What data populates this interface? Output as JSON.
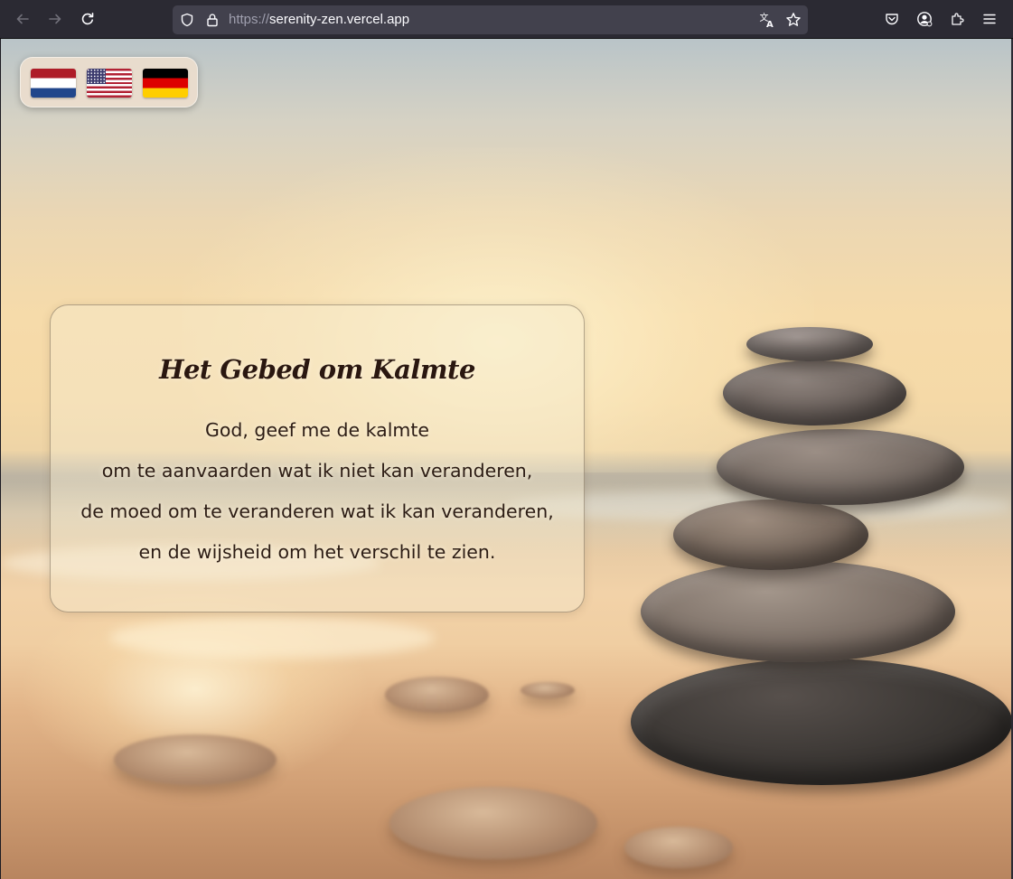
{
  "browser": {
    "url_scheme": "https://",
    "url_host": "serenity-zen.vercel.app",
    "icons": {
      "back": "arrow-left-icon",
      "forward": "arrow-right-icon",
      "reload": "reload-icon",
      "tracking": "shield-icon",
      "lock": "lock-icon",
      "translate": "translate-icon",
      "bookmark": "star-icon",
      "pocket": "pocket-icon",
      "account": "account-icon",
      "extensions": "puzzle-icon",
      "menu": "hamburger-menu-icon"
    }
  },
  "languages": [
    {
      "code": "nl",
      "icon": "flag-netherlands-icon"
    },
    {
      "code": "en",
      "icon": "flag-usa-icon"
    },
    {
      "code": "de",
      "icon": "flag-germany-icon"
    }
  ],
  "prayer": {
    "title": "Het Gebed om Kalmte",
    "lines": [
      "God, geef me de kalmte",
      "om te aanvaarden wat ik niet kan veranderen,",
      "de moed om te veranderen wat ik kan veranderen,",
      "en de wijsheid om het verschil te zien."
    ]
  },
  "colors": {
    "toolbar": "#2b2a33",
    "urlbar": "#42414d",
    "title_text": "#2a1710",
    "body_text": "#2c1c14"
  }
}
